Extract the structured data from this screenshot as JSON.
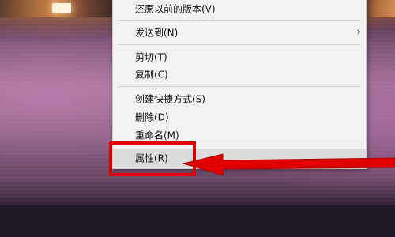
{
  "context_menu": {
    "items": [
      {
        "id": "restore",
        "label": "还原以前的版本(V)"
      },
      {
        "id": "send-to",
        "label": "发送到(N)",
        "has_submenu": true,
        "submenu_icon": "chevron-right-icon"
      },
      {
        "id": "cut",
        "label": "剪切(T)"
      },
      {
        "id": "copy",
        "label": "复制(C)"
      },
      {
        "id": "create-shortcut",
        "label": "创建快捷方式(S)"
      },
      {
        "id": "delete",
        "label": "删除(D)"
      },
      {
        "id": "rename",
        "label": "重命名(M)"
      },
      {
        "id": "properties",
        "label": "属性(R)",
        "highlighted": true
      }
    ],
    "submenu_arrow": "›"
  },
  "annotation": {
    "color": "#e00000",
    "highlight_target": "properties",
    "arrow_icon": "arrow-left-icon"
  }
}
